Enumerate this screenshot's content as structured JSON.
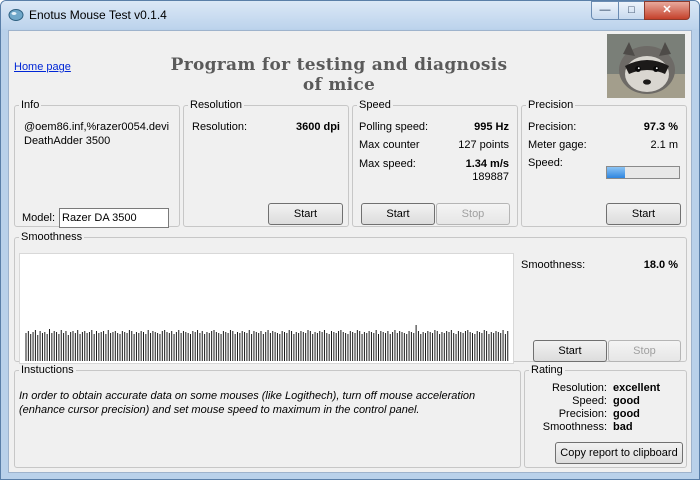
{
  "window": {
    "title": "Enotus Mouse Test v0.1.4"
  },
  "controls": {
    "minimize": "—",
    "maximize": "□",
    "close": "✕"
  },
  "header": {
    "home_link": "Home page",
    "title": "Program for testing and diagnosis of mice",
    "logo_icon": "raccoon-photo"
  },
  "info": {
    "legend": "Info",
    "device_line1": "@oem86.inf,%razer0054.devi",
    "device_line2": "DeathAdder 3500",
    "model_label": "Model:",
    "model_value": "Razer DA 3500"
  },
  "resolution": {
    "legend": "Resolution",
    "label": "Resolution:",
    "value": "3600 dpi",
    "start": "Start"
  },
  "speed": {
    "legend": "Speed",
    "polling_label": "Polling speed:",
    "polling_value": "995 Hz",
    "counter_label": "Max counter",
    "counter_value": "127 points",
    "maxspeed_label": "Max  speed:",
    "maxspeed_value": "1.34 m/s",
    "maxspeed_sub": "189887",
    "start": "Start",
    "stop": "Stop"
  },
  "precision": {
    "legend": "Precision",
    "precision_label": "Precision:",
    "precision_value": "97.3 %",
    "meter_label": "Meter gage:",
    "meter_value": "2.1 m",
    "speed_label": "Speed:",
    "speed_level": 0.25,
    "start": "Start"
  },
  "smoothness": {
    "legend": "Smoothness",
    "label": "Smoothness:",
    "value": "18.0 %",
    "start": "Start",
    "stop": "Stop",
    "bars": [
      28,
      30,
      27,
      29,
      31,
      26,
      30,
      28,
      29,
      27,
      32,
      28,
      30,
      29,
      27,
      31,
      28,
      30,
      26,
      29,
      30,
      28,
      31,
      27,
      29,
      30,
      28,
      29,
      31,
      27,
      30,
      28,
      29,
      30,
      27,
      31,
      28,
      29,
      30,
      28,
      27,
      30,
      29,
      28,
      31,
      30,
      27,
      29,
      28,
      30,
      29,
      27,
      31,
      28,
      30,
      29,
      28,
      27,
      30,
      31,
      29,
      28,
      30,
      27,
      29,
      31,
      28,
      30,
      29,
      28,
      27,
      30,
      29,
      31,
      28,
      30,
      27,
      29,
      28,
      30,
      31,
      29,
      28,
      27,
      30,
      29,
      28,
      31,
      30,
      27,
      29,
      28,
      30,
      29,
      28,
      31,
      27,
      30,
      29,
      28,
      30,
      27,
      29,
      31,
      28,
      30,
      29,
      28,
      27,
      30,
      29,
      28,
      31,
      30,
      27,
      29,
      28,
      30,
      29,
      28,
      31,
      30,
      27,
      29,
      28,
      30,
      29,
      31,
      28,
      27,
      30,
      29,
      28,
      30,
      31,
      29,
      28,
      27,
      30,
      29,
      28,
      31,
      30,
      27,
      29,
      28,
      30,
      29,
      28,
      31,
      27,
      30,
      29,
      28,
      30,
      27,
      29,
      31,
      28,
      30,
      29,
      28,
      27,
      30,
      29,
      28,
      36,
      30,
      27,
      29,
      28,
      30,
      29,
      28,
      31,
      30,
      27,
      29,
      28,
      30,
      29,
      31,
      28,
      27,
      30,
      29,
      28,
      30,
      31,
      29,
      28,
      27,
      30,
      29,
      28,
      31,
      30,
      27,
      29,
      28,
      30,
      29,
      28,
      31,
      27,
      30,
      29,
      28,
      30,
      27
    ]
  },
  "instructions": {
    "legend": "Instuctions",
    "line1": "In order to obtain accurate data on some mouses (like Logithech), turn off mouse acceleration",
    "line2": "(enhance cursor precision) and set mouse speed to maximum in the control panel."
  },
  "rating": {
    "legend": "Rating",
    "rows": [
      {
        "label": "Resolution:",
        "value": "excellent"
      },
      {
        "label": "Speed:",
        "value": "good"
      },
      {
        "label": "Precision:",
        "value": "good"
      },
      {
        "label": "Smoothness:",
        "value": "bad"
      }
    ],
    "copy_button": "Copy report to clipboard"
  }
}
